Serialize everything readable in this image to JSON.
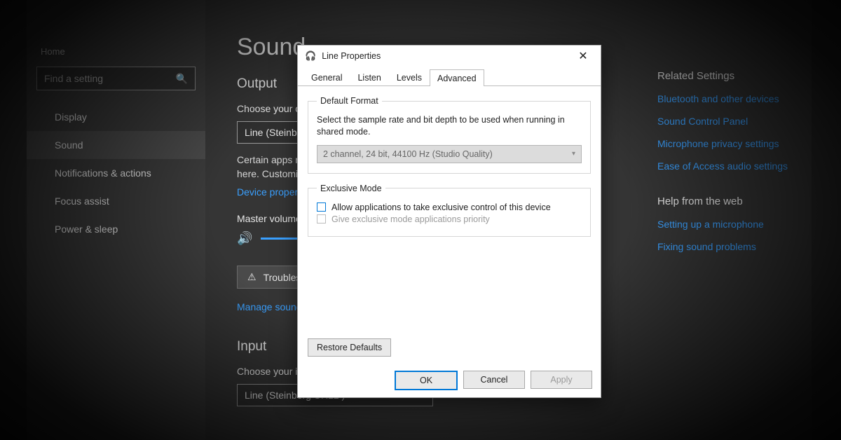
{
  "settings": {
    "home_label": "Home",
    "search_placeholder": "Find a setting",
    "nav": {
      "display": "Display",
      "sound": "Sound",
      "notifications": "Notifications & actions",
      "focus": "Focus assist",
      "power": "Power & sleep"
    },
    "page_title": "Sound",
    "output_header": "Output",
    "choose_output_label": "Choose your output device",
    "output_device": "Line (Steinberg UR12 )",
    "output_desc": "Certain apps may be set up to use different sound devices than the one selected here. Customize app volumes and devices in advanced sound options.",
    "device_properties": "Device properties",
    "master_volume_label": "Master volume",
    "troubleshoot_label": "Troubleshoot",
    "manage_sound": "Manage sound devices",
    "input_header": "Input",
    "choose_input_label": "Choose your input device",
    "input_device": "Line (Steinberg UR12 )"
  },
  "rightcol": {
    "related_header": "Related Settings",
    "bluetooth": "Bluetooth and other devices",
    "panel": "Sound Control Panel",
    "mic": "Microphone privacy settings",
    "ease": "Ease of Access audio settings",
    "help_header": "Help from the web",
    "setup_mic": "Setting up a microphone",
    "fixing": "Fixing sound problems"
  },
  "dialog": {
    "title": "Line Properties",
    "tabs": {
      "general": "General",
      "listen": "Listen",
      "levels": "Levels",
      "advanced": "Advanced"
    },
    "default_format_legend": "Default Format",
    "default_format_desc": "Select the sample rate and bit depth to be used when running in shared mode.",
    "format_value": "2 channel, 24 bit, 44100 Hz (Studio Quality)",
    "exclusive_legend": "Exclusive Mode",
    "exclusive_opt1": "Allow applications to take exclusive control of this device",
    "exclusive_opt2": "Give exclusive mode applications priority",
    "restore_defaults": "Restore Defaults",
    "ok": "OK",
    "cancel": "Cancel",
    "apply": "Apply"
  }
}
